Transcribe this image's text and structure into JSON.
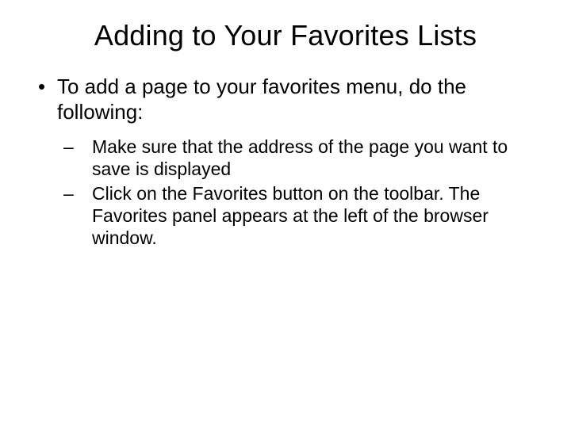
{
  "title": "Adding to Your Favorites Lists",
  "bullet1": "To add a page to your favorites menu, do the following:",
  "sub1": "Make sure that the address of the page you want to save is displayed",
  "sub2": "Click on the Favorites button on the toolbar. The Favorites panel appears at the left of the browser window."
}
